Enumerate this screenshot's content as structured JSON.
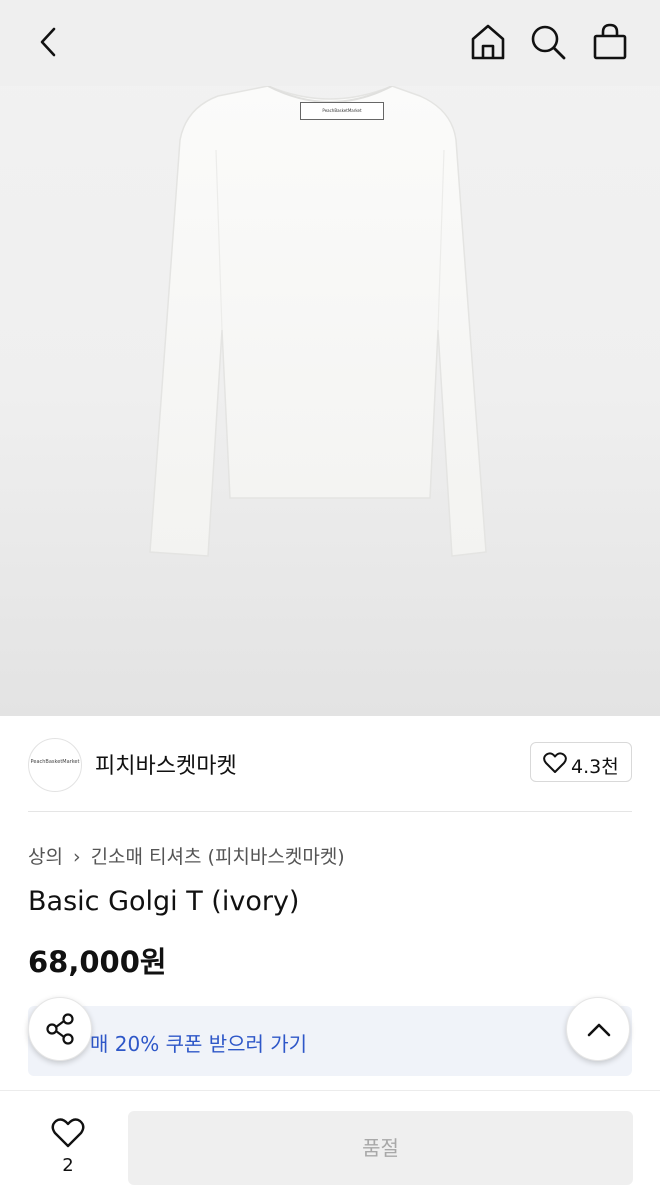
{
  "header": {
    "back_icon": "chevron-left-icon",
    "home_icon": "home-icon",
    "search_icon": "search-icon",
    "cart_icon": "shopping-bag-icon"
  },
  "product_image": {
    "tag_text": "PeachBasketMarket"
  },
  "store": {
    "logo_text": "PeachBasketMarket",
    "name": "피치바스켓마켓",
    "like_count": "4.3천"
  },
  "breadcrumb": {
    "category": "상의",
    "subcategory": "긴소매 티셔츠 (피치바스켓마켓)"
  },
  "product": {
    "title": "Basic Golgi T (ivory)",
    "price": "68,000원"
  },
  "coupon": {
    "text": "매 20% 쿠폰 받으러 가기"
  },
  "bottom": {
    "wish_count": "2",
    "action_label": "품절"
  },
  "colors": {
    "coupon_text": "#2e57c8",
    "coupon_bg": "#f0f3f9",
    "disabled_button": "#efefef"
  }
}
